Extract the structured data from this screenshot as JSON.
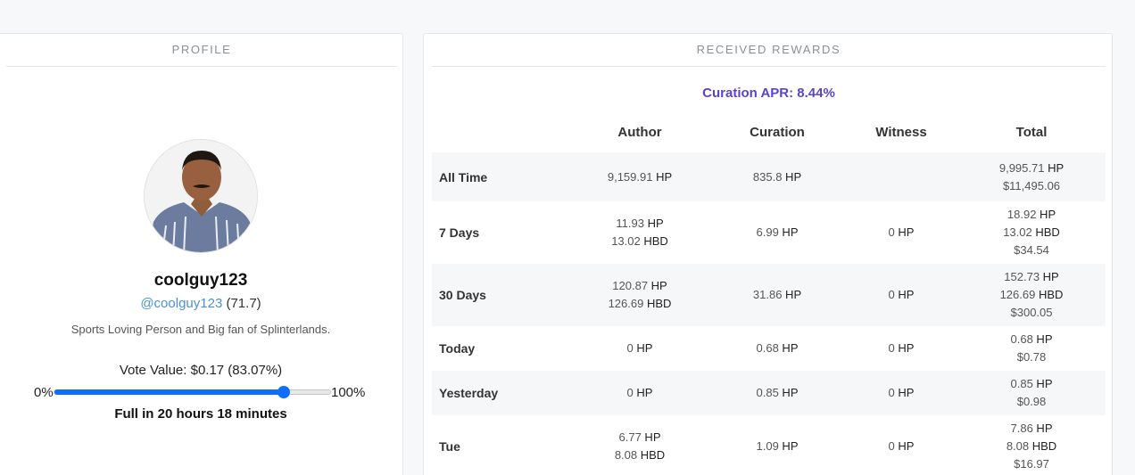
{
  "profile": {
    "header": "PROFILE",
    "display_name": "coolguy123",
    "handle": "@coolguy123",
    "reputation": "(71.7)",
    "about": "Sports Loving Person and Big fan of Splinterlands.",
    "vote_value": "Vote Value: $0.17 (83.07%)",
    "slider_min": "0%",
    "slider_max": "100%",
    "voting_power_percent": 83.07,
    "full_in": "Full in 20 hours 18 minutes"
  },
  "rewards": {
    "header": "RECEIVED REWARDS",
    "apr": "Curation APR: 8.44%",
    "columns": [
      "Author",
      "Curation",
      "Witness",
      "Total"
    ],
    "rows": [
      {
        "label": "All Time",
        "author": [
          [
            "9,159.91",
            "HP"
          ]
        ],
        "curation": [
          [
            "835.8",
            "HP"
          ]
        ],
        "witness": [],
        "total": [
          [
            "9,995.71",
            "HP"
          ],
          [
            "$11,495.06",
            ""
          ]
        ]
      },
      {
        "label": "7 Days",
        "author": [
          [
            "11.93",
            "HP"
          ],
          [
            "13.02",
            "HBD"
          ]
        ],
        "curation": [
          [
            "6.99",
            "HP"
          ]
        ],
        "witness": [
          [
            "0",
            "HP"
          ]
        ],
        "total": [
          [
            "18.92",
            "HP"
          ],
          [
            "13.02",
            "HBD"
          ],
          [
            "$34.54",
            ""
          ]
        ]
      },
      {
        "label": "30 Days",
        "author": [
          [
            "120.87",
            "HP"
          ],
          [
            "126.69",
            "HBD"
          ]
        ],
        "curation": [
          [
            "31.86",
            "HP"
          ]
        ],
        "witness": [
          [
            "0",
            "HP"
          ]
        ],
        "total": [
          [
            "152.73",
            "HP"
          ],
          [
            "126.69",
            "HBD"
          ],
          [
            "$300.05",
            ""
          ]
        ]
      },
      {
        "label": "Today",
        "author": [
          [
            "0",
            "HP"
          ]
        ],
        "curation": [
          [
            "0.68",
            "HP"
          ]
        ],
        "witness": [
          [
            "0",
            "HP"
          ]
        ],
        "total": [
          [
            "0.68",
            "HP"
          ],
          [
            "$0.78",
            ""
          ]
        ]
      },
      {
        "label": "Yesterday",
        "author": [
          [
            "0",
            "HP"
          ]
        ],
        "curation": [
          [
            "0.85",
            "HP"
          ]
        ],
        "witness": [
          [
            "0",
            "HP"
          ]
        ],
        "total": [
          [
            "0.85",
            "HP"
          ],
          [
            "$0.98",
            ""
          ]
        ]
      },
      {
        "label": "Tue",
        "author": [
          [
            "6.77",
            "HP"
          ],
          [
            "8.08",
            "HBD"
          ]
        ],
        "curation": [
          [
            "1.09",
            "HP"
          ]
        ],
        "witness": [
          [
            "0",
            "HP"
          ]
        ],
        "total": [
          [
            "7.86",
            "HP"
          ],
          [
            "8.08",
            "HBD"
          ],
          [
            "$16.97",
            ""
          ]
        ]
      }
    ]
  },
  "colors": {
    "accent": "#0d6efd",
    "apr": "#5a43cf",
    "link": "#4a90d9"
  }
}
